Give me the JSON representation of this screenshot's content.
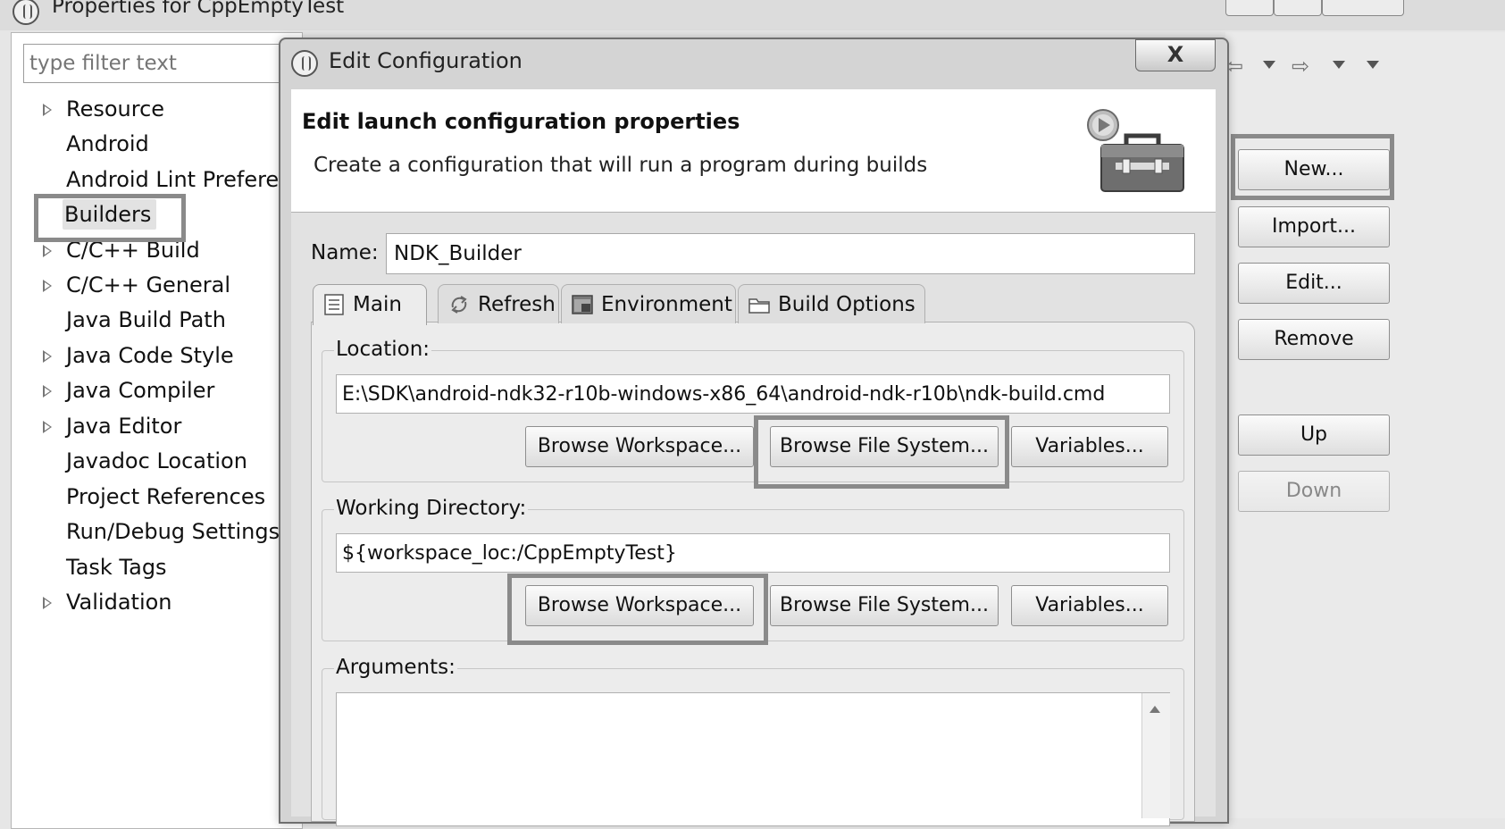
{
  "background_window": {
    "title": "Properties for CppEmptyTest",
    "filter_placeholder": "type filter text",
    "tree": [
      {
        "label": "Resource",
        "expandable": true
      },
      {
        "label": "Android",
        "expandable": false
      },
      {
        "label": "Android Lint Preferer",
        "expandable": false
      },
      {
        "label": "Builders",
        "expandable": false,
        "selected": true
      },
      {
        "label": "C/C++ Build",
        "expandable": true
      },
      {
        "label": "C/C++ General",
        "expandable": true
      },
      {
        "label": "Java Build Path",
        "expandable": false
      },
      {
        "label": "Java Code Style",
        "expandable": true
      },
      {
        "label": "Java Compiler",
        "expandable": true
      },
      {
        "label": "Java Editor",
        "expandable": true
      },
      {
        "label": "Javadoc Location",
        "expandable": false
      },
      {
        "label": "Project References",
        "expandable": false
      },
      {
        "label": "Run/Debug Settings",
        "expandable": false
      },
      {
        "label": "Task Tags",
        "expandable": false
      },
      {
        "label": "Validation",
        "expandable": true
      }
    ],
    "side_buttons": {
      "new": "New...",
      "import": "Import...",
      "edit": "Edit...",
      "remove": "Remove",
      "up": "Up",
      "down": "Down"
    }
  },
  "dialog": {
    "title": "Edit Configuration",
    "close_glyph": "X",
    "banner_title": "Edit launch configuration properties",
    "banner_description": "Create a configuration that will run a program during builds",
    "name_label": "Name:",
    "name_value": "NDK_Builder",
    "tabs": [
      {
        "label": "Main",
        "active": true,
        "icon": "document-icon"
      },
      {
        "label": "Refresh",
        "active": false,
        "icon": "refresh-icon"
      },
      {
        "label": "Environment",
        "active": false,
        "icon": "environment-icon"
      },
      {
        "label": "Build Options",
        "active": false,
        "icon": "folder-icon"
      }
    ],
    "location": {
      "label": "Location:",
      "value": "E:\\SDK\\android-ndk32-r10b-windows-x86_64\\android-ndk-r10b\\ndk-build.cmd",
      "browse_workspace": "Browse Workspace...",
      "browse_file_system": "Browse File System...",
      "variables": "Variables..."
    },
    "working_directory": {
      "label": "Working Directory:",
      "value": "${workspace_loc:/CppEmptyTest}",
      "browse_workspace": "Browse Workspace...",
      "browse_file_system": "Browse File System...",
      "variables": "Variables..."
    },
    "arguments": {
      "label": "Arguments:",
      "value": ""
    }
  },
  "colors": {
    "highlight_box": "#8a8a8a",
    "dialog_frame": "#6f6f6f",
    "banner_bg": "#ffffff"
  }
}
